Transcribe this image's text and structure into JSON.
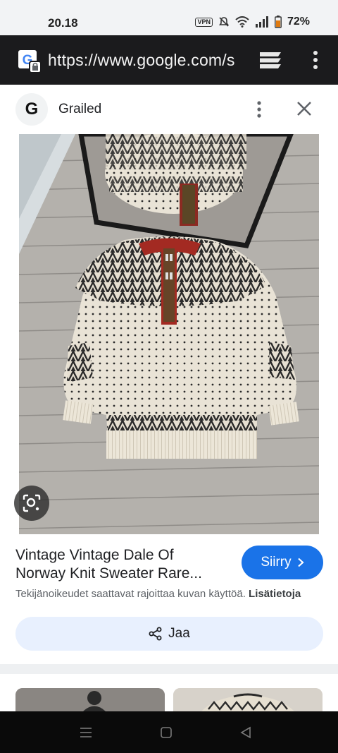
{
  "status_bar": {
    "time": "20.18",
    "vpn_label": "VPN",
    "battery": "72%"
  },
  "url_bar": {
    "url": "https://www.google.com/s",
    "icons": [
      "google-lens-icon",
      "tab-switcher-icon",
      "more-vert-icon"
    ]
  },
  "card": {
    "favicon_letter": "G",
    "site_name": "Grailed",
    "icons": [
      "more-vert-icon",
      "close-icon"
    ]
  },
  "result": {
    "title_line1": "Vintage Vintage Dale Of",
    "title_line2": "Norway Knit Sweater Rare...",
    "goto_label": "Siirry",
    "copyright_text": "Tekijänoikeudet saattavat rajoittaa kuvan käyttöä.",
    "learn_more_label": "Lisätietoja",
    "share_label": "Jaa"
  },
  "colors": {
    "accent": "#1a73e8",
    "share_bg": "#e8f0fe",
    "urlbar_bg": "#1b1b1d"
  }
}
